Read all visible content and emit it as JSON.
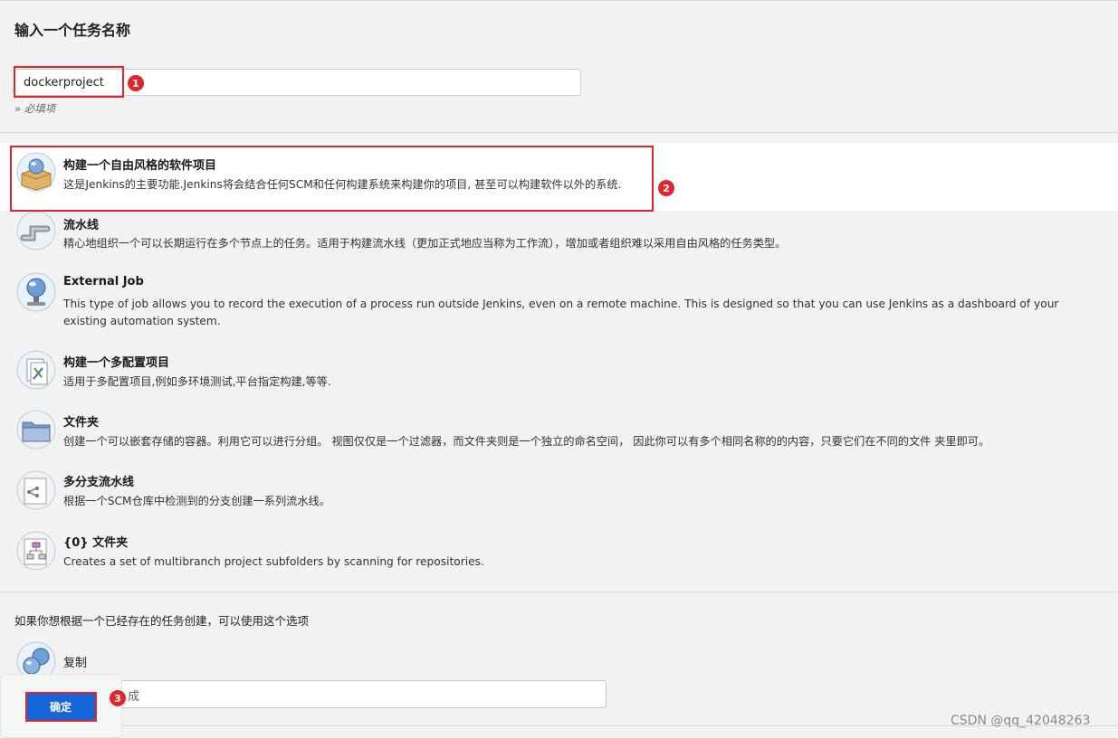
{
  "page_title": "输入一个任务名称",
  "name_field": {
    "value": "dockerproject",
    "hint": "» 必填项"
  },
  "item_types": [
    {
      "icon": "freestyle-icon",
      "title": "构建一个自由风格的软件项目",
      "description": "这是Jenkins的主要功能.Jenkins将会结合任何SCM和任何构建系统来构建你的项目, 甚至可以构建软件以外的系统."
    },
    {
      "icon": "pipeline-icon",
      "title": "流水线",
      "description": "精心地组织一个可以长期运行在多个节点上的任务。适用于构建流水线（更加正式地应当称为工作流），增加或者组织难以采用自由风格的任务类型。"
    },
    {
      "icon": "external-job-icon",
      "title": "External Job",
      "description": "This type of job allows you to record the execution of a process run outside Jenkins, even on a remote machine. This is designed so that you can use Jenkins as a dashboard of your existing automation system."
    },
    {
      "icon": "multi-config-icon",
      "title": "构建一个多配置项目",
      "description": "适用于多配置项目,例如多环境测试,平台指定构建,等等."
    },
    {
      "icon": "folder-icon",
      "title": "文件夹",
      "description": "创建一个可以嵌套存储的容器。利用它可以进行分组。 视图仅仅是一个过滤器，而文件夹则是一个独立的命名空间， 因此你可以有多个相同名称的的内容，只要它们在不同的文件 夹里即可。"
    },
    {
      "icon": "multibranch-pipeline-icon",
      "title": "多分支流水线",
      "description": "根据一个SCM仓库中检测到的分支创建一系列流水线。"
    },
    {
      "icon": "organization-folder-icon",
      "title": "{0} 文件夹",
      "description": "Creates a set of multibranch project subfolders by scanning for repositories."
    }
  ],
  "copy_section": {
    "label": "如果你想根据一个已经存在的任务创建，可以使用这个选项",
    "title": "复制",
    "input_visible_text": "成"
  },
  "ok_button": "确定",
  "annotations": [
    "1",
    "2",
    "3"
  ],
  "watermark": "CSDN @qq_42048263",
  "colors": {
    "accent": "#1565d8",
    "highlight": "#e0262c"
  }
}
